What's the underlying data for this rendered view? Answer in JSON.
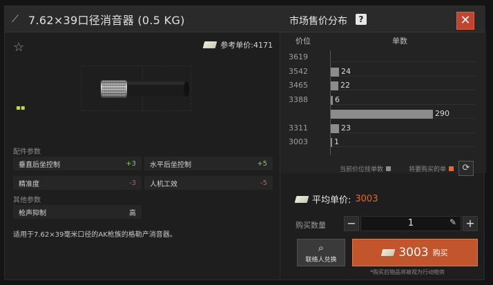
{
  "header": {
    "title": "7.62×39口径消音器 (0.5 KG)",
    "distribution_title": "市场售价分布",
    "help_icon": "?",
    "close_icon": "✕"
  },
  "item": {
    "reference_label": "参考单价:",
    "reference_price": "4171",
    "attachment_section": "配件参数",
    "other_section": "其他参数",
    "stats": [
      {
        "label": "垂直后坐控制",
        "value": "+3",
        "tone": "positive"
      },
      {
        "label": "水平后坐控制",
        "value": "+5",
        "tone": "positive"
      },
      {
        "label": "精准度",
        "value": "-3",
        "tone": "negative"
      },
      {
        "label": "人机工效",
        "value": "-5",
        "tone": "negative"
      }
    ],
    "other_stats": [
      {
        "label": "枪声抑制",
        "value": "高"
      }
    ],
    "description": "适用于7.62×39毫米口径的AK枪族的格勒产消音器。"
  },
  "market": {
    "col_price": "价位",
    "col_count": "单数",
    "legend_current": "当前价位挂单数",
    "legend_buy": "将要购买的单",
    "avg_label": "平均单价:",
    "avg_value": "3003",
    "qty_label": "购买数量",
    "qty_value": "1",
    "minus": "−",
    "plus": "+",
    "contact_label": "联络人兑换",
    "buy_price": "3003",
    "buy_label": "购买",
    "buy_note": "*购买后物品将被视为行动物资"
  },
  "chart_data": {
    "type": "bar",
    "orientation": "horizontal",
    "categories": [
      "3619",
      "3542",
      "3465",
      "3388",
      "3311",
      "3003"
    ],
    "values": [
      0,
      24,
      22,
      6,
      290,
      23,
      1
    ],
    "rows": [
      {
        "price": "3619",
        "count": null
      },
      {
        "price": "3542",
        "count": 24
      },
      {
        "price": "3465",
        "count": 22
      },
      {
        "price": "3388",
        "count": 6
      },
      {
        "price": null,
        "count": 290
      },
      {
        "price": "3311",
        "count": 23
      },
      {
        "price": "3003",
        "count": 1
      }
    ],
    "xlabel": "单数",
    "ylabel": "价位",
    "xlim": [
      0,
      290
    ]
  }
}
